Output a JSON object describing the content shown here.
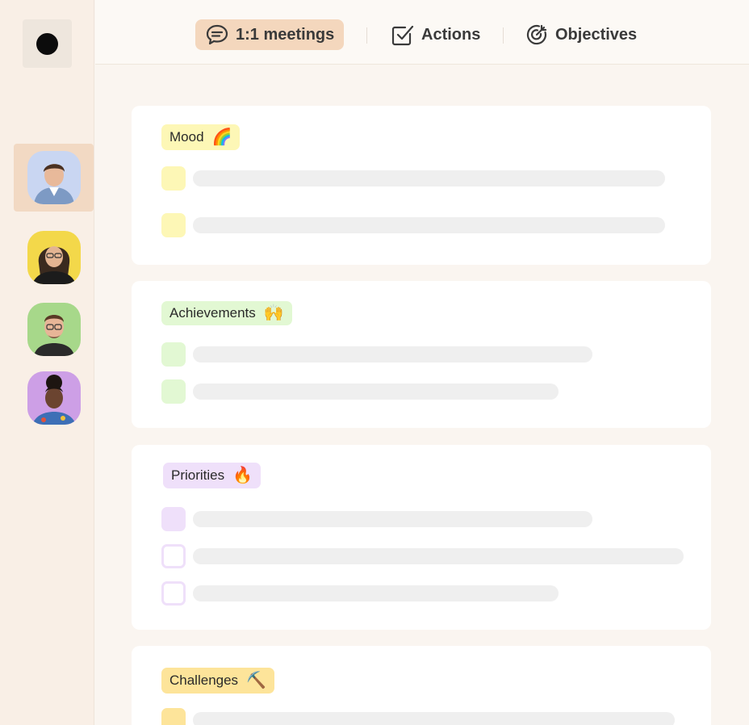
{
  "nav": {
    "tabs": [
      {
        "label": "1:1 meetings",
        "icon": "speech-bubble-icon",
        "active": true
      },
      {
        "label": "Actions",
        "icon": "checkbox-icon",
        "active": false
      },
      {
        "label": "Objectives",
        "icon": "target-icon",
        "active": false
      }
    ]
  },
  "sidebar": {
    "logo": "logo-dot",
    "avatars": [
      {
        "name": "avatar-person-1",
        "bg": "#c9d6f2",
        "active": true
      },
      {
        "name": "avatar-person-2",
        "bg": "#f3d84a",
        "active": false
      },
      {
        "name": "avatar-person-3",
        "bg": "#a7d88a",
        "active": false
      },
      {
        "name": "avatar-person-4",
        "bg": "#cd9fe6",
        "active": false
      }
    ]
  },
  "sections": [
    {
      "title": "Mood",
      "emoji": "🌈",
      "tag_color": "#fdf7b6",
      "check_color": "#fdf7b6",
      "rows": 2
    },
    {
      "title": "Achievements",
      "emoji": "🙌",
      "tag_color": "#e2f8d3",
      "check_color": "#e2f8d3",
      "rows": 2
    },
    {
      "title": "Priorities",
      "emoji": "🔥",
      "tag_color": "#efe0fa",
      "check_color": "#efe0fa",
      "rows": 3
    },
    {
      "title": "Challenges",
      "emoji": "⛏️",
      "tag_color": "#fde49a",
      "check_color": "#fde49a",
      "rows": 1
    }
  ],
  "colors": {
    "sidebar_bg": "#f9efe6",
    "active_nav": "#f4d7bd",
    "placeholder_bar": "#efefef"
  }
}
